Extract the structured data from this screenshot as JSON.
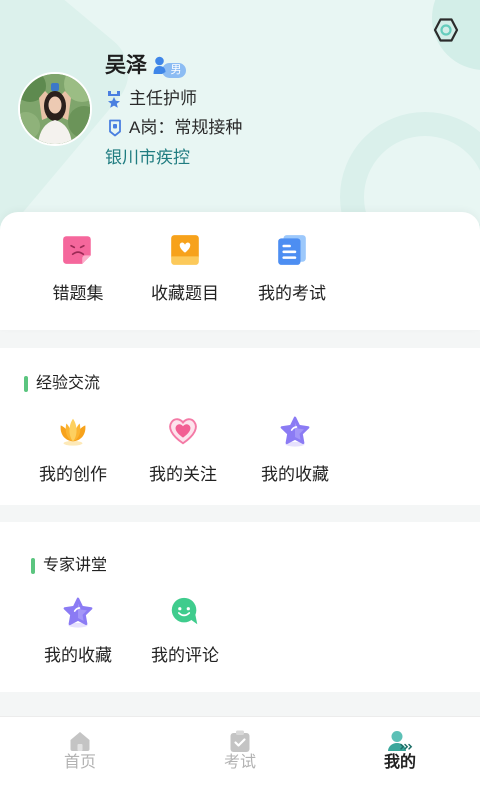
{
  "header": {
    "settings_icon": "hexagon-settings-icon",
    "avatar_icon": "user-avatar-photo",
    "profile": {
      "name": "吴泽",
      "gender": "男",
      "gender_icon": "person-icon",
      "title": "主任护师",
      "title_icon": "medal-icon",
      "post": "A岗：常规接种",
      "post_icon": "badge-icon",
      "organization": "银川市疾控"
    }
  },
  "quick_actions": [
    {
      "label": "错题集",
      "icon": "wrong-questions-icon",
      "color": "#f5679c"
    },
    {
      "label": "收藏题目",
      "icon": "favorite-questions-icon",
      "color": "#f7a21b"
    },
    {
      "label": "我的考试",
      "icon": "my-exams-icon",
      "color": "#4d8ef2"
    }
  ],
  "sections": [
    {
      "title": "经验交流",
      "items": [
        {
          "label": "我的创作",
          "icon": "lotus-icon",
          "color": "#fbb431"
        },
        {
          "label": "我的关注",
          "icon": "heart-icon",
          "color": "#f25f93"
        },
        {
          "label": "我的收藏",
          "icon": "star-icon",
          "color": "#8b7bf4"
        }
      ]
    },
    {
      "title": "专家讲堂",
      "items": [
        {
          "label": "我的收藏",
          "icon": "star-icon",
          "color": "#8b7bf4"
        },
        {
          "label": "我的评论",
          "icon": "comment-icon",
          "color": "#3fcc8d"
        }
      ]
    }
  ],
  "tabbar": {
    "items": [
      {
        "label": "首页",
        "icon": "home-icon",
        "active": false
      },
      {
        "label": "考试",
        "icon": "exam-icon",
        "active": false
      },
      {
        "label": "我的",
        "icon": "profile-icon",
        "active": true
      }
    ]
  },
  "theme": {
    "header_background": "#e8f6f3",
    "accent": "#1f7c80",
    "section_marker": "#5bc57f",
    "info_icon_color": "#4a7fe0",
    "tab_active": "#222222",
    "tab_inactive": "#b2b2b2"
  }
}
